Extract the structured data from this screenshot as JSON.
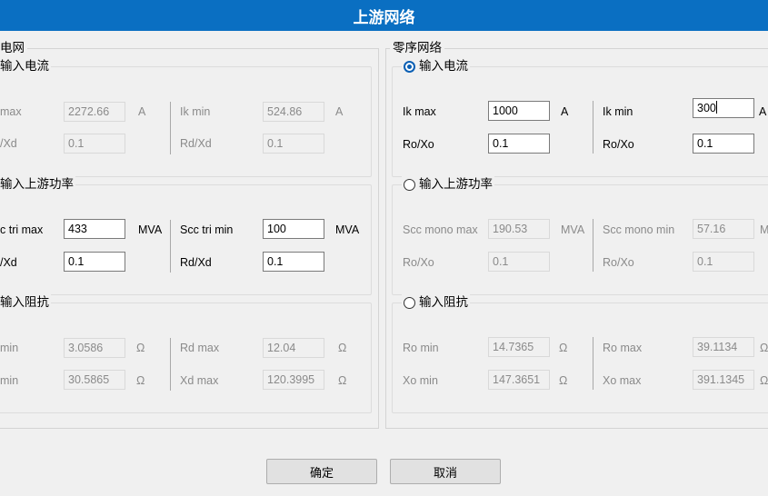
{
  "window": {
    "title": "上游网络"
  },
  "grid": {
    "legend": "电网",
    "current": {
      "label": "输入电流",
      "ik_max_label": "max",
      "ik_max_value": "2272.66",
      "ik_max_unit": "A",
      "ik_min_label": "Ik min",
      "ik_min_value": "524.86",
      "ik_min_unit": "A",
      "rdxd_label": "/Xd",
      "rdxd_value": "0.1",
      "rdxd2_label": "Rd/Xd",
      "rdxd2_value": "0.1"
    },
    "power": {
      "label": "输入上游功率",
      "scc_max_label": "c tri max",
      "scc_max_value": "433",
      "scc_max_unit": "MVA",
      "scc_min_label": "Scc tri min",
      "scc_min_value": "100",
      "scc_min_unit": "MVA",
      "rdxd_label": "/Xd",
      "rdxd_value": "0.1",
      "rdxd2_label": "Rd/Xd",
      "rdxd2_value": "0.1"
    },
    "impedance": {
      "label": "输入阻抗",
      "r_min_label": "min",
      "r_min_value": "3.0586",
      "r_min_unit": "Ω",
      "rd_max_label": "Rd max",
      "rd_max_value": "12.04",
      "rd_max_unit": "Ω",
      "x_min_label": "min",
      "x_min_value": "30.5865",
      "x_min_unit": "Ω",
      "xd_max_label": "Xd max",
      "xd_max_value": "120.3995",
      "xd_max_unit": "Ω"
    }
  },
  "zero": {
    "legend": "零序网络",
    "current": {
      "label": "输入电流",
      "ik_max_label": "Ik max",
      "ik_max_value": "1000",
      "ik_max_unit": "A",
      "ik_min_label": "Ik min",
      "ik_min_value": "300",
      "ik_min_unit": "A",
      "roxo_label": "Ro/Xo",
      "roxo_value": "0.1",
      "roxo2_label": "Ro/Xo",
      "roxo2_value": "0.1"
    },
    "power": {
      "label": "输入上游功率",
      "scc_max_label": "Scc mono max",
      "scc_max_value": "190.53",
      "scc_max_unit": "MVA",
      "scc_min_label": "Scc mono min",
      "scc_min_value": "57.16",
      "scc_min_unit": "M",
      "roxo_label": "Ro/Xo",
      "roxo_value": "0.1",
      "roxo2_label": "Ro/Xo",
      "roxo2_value": "0.1"
    },
    "impedance": {
      "label": "输入阻抗",
      "ro_min_label": "Ro min",
      "ro_min_value": "14.7365",
      "ro_min_unit": "Ω",
      "ro_max_label": "Ro max",
      "ro_max_value": "39.1134",
      "ro_max_unit": "Ω",
      "xo_min_label": "Xo min",
      "xo_min_value": "147.3651",
      "xo_min_unit": "Ω",
      "xo_max_label": "Xo max",
      "xo_max_value": "391.1345",
      "xo_max_unit": "Ω"
    }
  },
  "buttons": {
    "ok": "确定",
    "cancel": "取消"
  }
}
